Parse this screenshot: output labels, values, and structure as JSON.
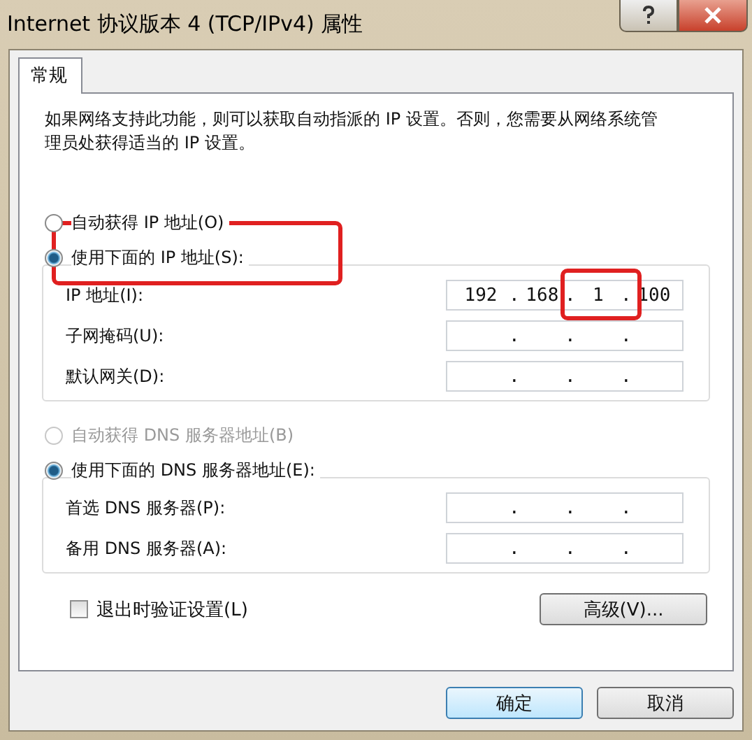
{
  "window": {
    "title": "Internet 协议版本 4 (TCP/IPv4) 属性"
  },
  "tabs": [
    {
      "label": "常规",
      "selected": true
    }
  ],
  "description": "如果网络支持此功能，则可以获取自动指派的 IP 设置。否则，您需要从网络系统管理员处获得适当的 IP 设置。",
  "separator": ".",
  "ip_section": {
    "radios": [
      {
        "label": "自动获得 IP 地址(O)",
        "selected": false,
        "disabled": false
      },
      {
        "label": "使用下面的 IP 地址(S):",
        "selected": true,
        "disabled": false
      }
    ],
    "fields": [
      {
        "label": "IP 地址(I):",
        "segments": [
          "192",
          "168",
          "1",
          "100"
        ]
      },
      {
        "label": "子网掩码(U):"
      },
      {
        "label": "默认网关(D):"
      }
    ]
  },
  "dns_section": {
    "radios": [
      {
        "label": "自动获得 DNS 服务器地址(B)",
        "selected": false,
        "disabled": true
      },
      {
        "label": "使用下面的 DNS 服务器地址(E):",
        "selected": true,
        "disabled": false
      }
    ],
    "fields": [
      {
        "label": "首选 DNS 服务器(P):"
      },
      {
        "label": "备用 DNS 服务器(A):"
      }
    ]
  },
  "validate_checkbox": {
    "label": "退出时验证设置(L)",
    "checked": false
  },
  "advanced_button": "高级(V)...",
  "buttons": [
    {
      "label": "确定",
      "default": true
    },
    {
      "label": "取消",
      "default": false
    }
  ]
}
